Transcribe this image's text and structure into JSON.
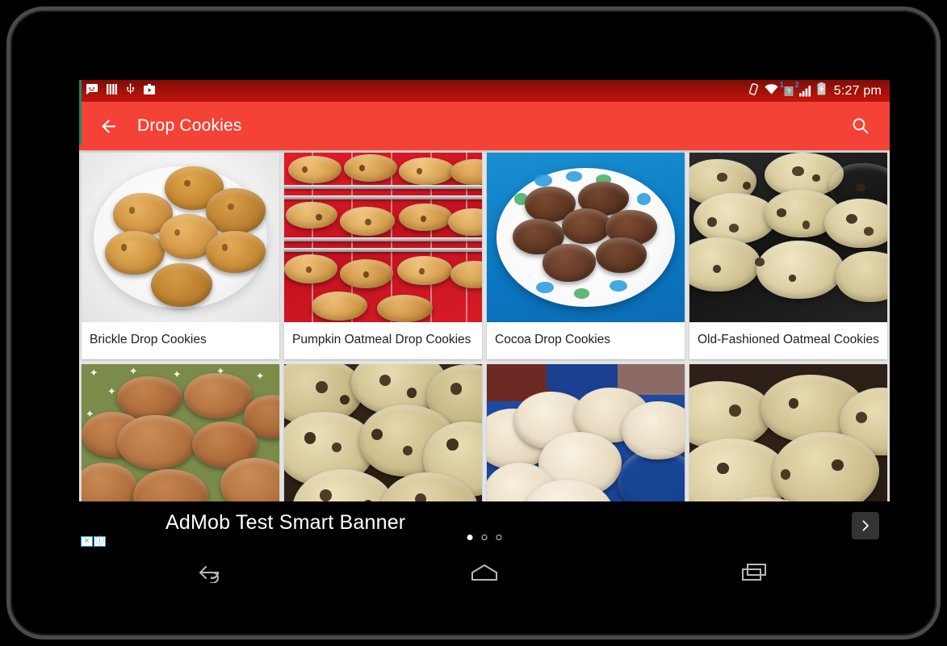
{
  "status_bar": {
    "left_icons": [
      "messaging-icon",
      "sim-toolkit-icon",
      "usb-icon",
      "media-icon"
    ],
    "right_icons": [
      "vibrate-icon",
      "wifi-icon",
      "sim1-unknown-signal-icon",
      "sim2-signal-icon",
      "battery-charging-icon"
    ],
    "sim1_label": "1",
    "sim2_label": "2",
    "sim1_glyph": "?",
    "time": "5:27 pm"
  },
  "toolbar": {
    "back_icon": "back-arrow-icon",
    "title": "Drop Cookies",
    "search_icon": "search-icon",
    "background": "#f44336"
  },
  "grid": {
    "cards": [
      {
        "title": "Brickle Drop Cookies",
        "photo": "white-plate-golden-cookies"
      },
      {
        "title": "Pumpkin Oatmeal Drop Cookies",
        "photo": "cooling-racks-red-table"
      },
      {
        "title": "Cocoa Drop Cookies",
        "photo": "floral-plate-chocolate-cookies"
      },
      {
        "title": "Old-Fashioned Oatmeal Cookies",
        "photo": "dark-plate-oatmeal-raisin"
      },
      {
        "title": "",
        "photo": "green-star-plate-brown-cookies"
      },
      {
        "title": "",
        "photo": "oatmeal-raisin-closeup"
      },
      {
        "title": "",
        "photo": "blue-plate-snickerdoodles"
      },
      {
        "title": "",
        "photo": "oatmeal-cookies-closeup"
      }
    ]
  },
  "ad": {
    "text": "AdMob Test Smart Banner",
    "close_badge": "×",
    "info_badge": "ⓘ",
    "dots": [
      true,
      false,
      false
    ],
    "next_icon": "chevron-right-icon"
  },
  "nav_bar": {
    "back_icon": "nav-back-icon",
    "home_icon": "nav-home-icon",
    "recents_icon": "nav-recents-icon"
  }
}
